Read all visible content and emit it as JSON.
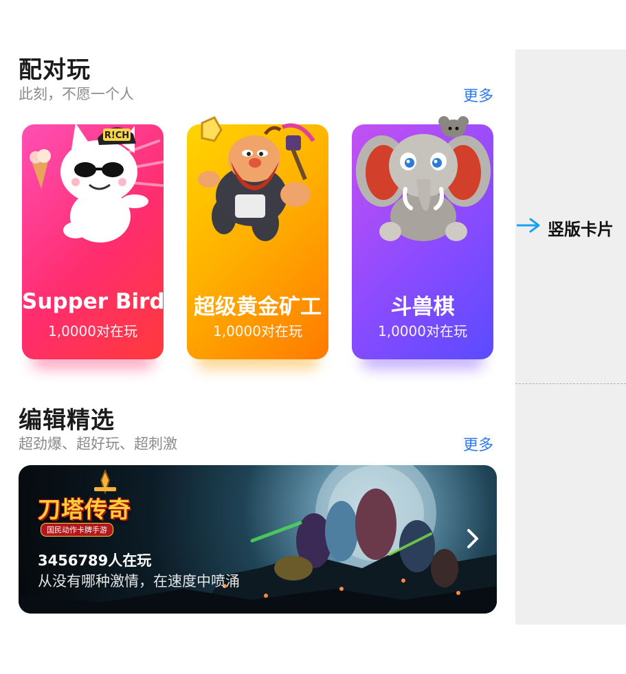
{
  "pair_section": {
    "title": "配对玩",
    "subtitle": "此刻，不愿一个人",
    "more_label": "更多",
    "cards": [
      {
        "name": "Supper Bird",
        "count": "1,0000对在玩",
        "icon": "white-cat-character",
        "badge": "R!CH"
      },
      {
        "name": "超级黄金矿工",
        "count": "1,0000对在玩",
        "icon": "dwarf-miner-character"
      },
      {
        "name": "斗兽棋",
        "count": "1,0000对在玩",
        "icon": "elephant-mouse-character"
      }
    ]
  },
  "editor_section": {
    "title": "编辑精选",
    "subtitle": "超劲爆、超好玩、超刺激",
    "more_label": "更多",
    "banner": {
      "logo_text": "刀塔传奇",
      "logo_tagline": "国民动作卡牌手游",
      "players": "3456789人在玩",
      "slogan": "从没有哪种激情，在速度中喷涌",
      "next_icon": "chevron-right-icon"
    }
  },
  "annotation": {
    "label": "竖版卡片",
    "arrow_color": "#1aa0f0"
  },
  "colors": {
    "accent_link": "#2d7bf0",
    "card1": "#ff2d6e",
    "card2": "#ffb100",
    "card3": "#8a4bff",
    "side_panel": "#efefef"
  }
}
